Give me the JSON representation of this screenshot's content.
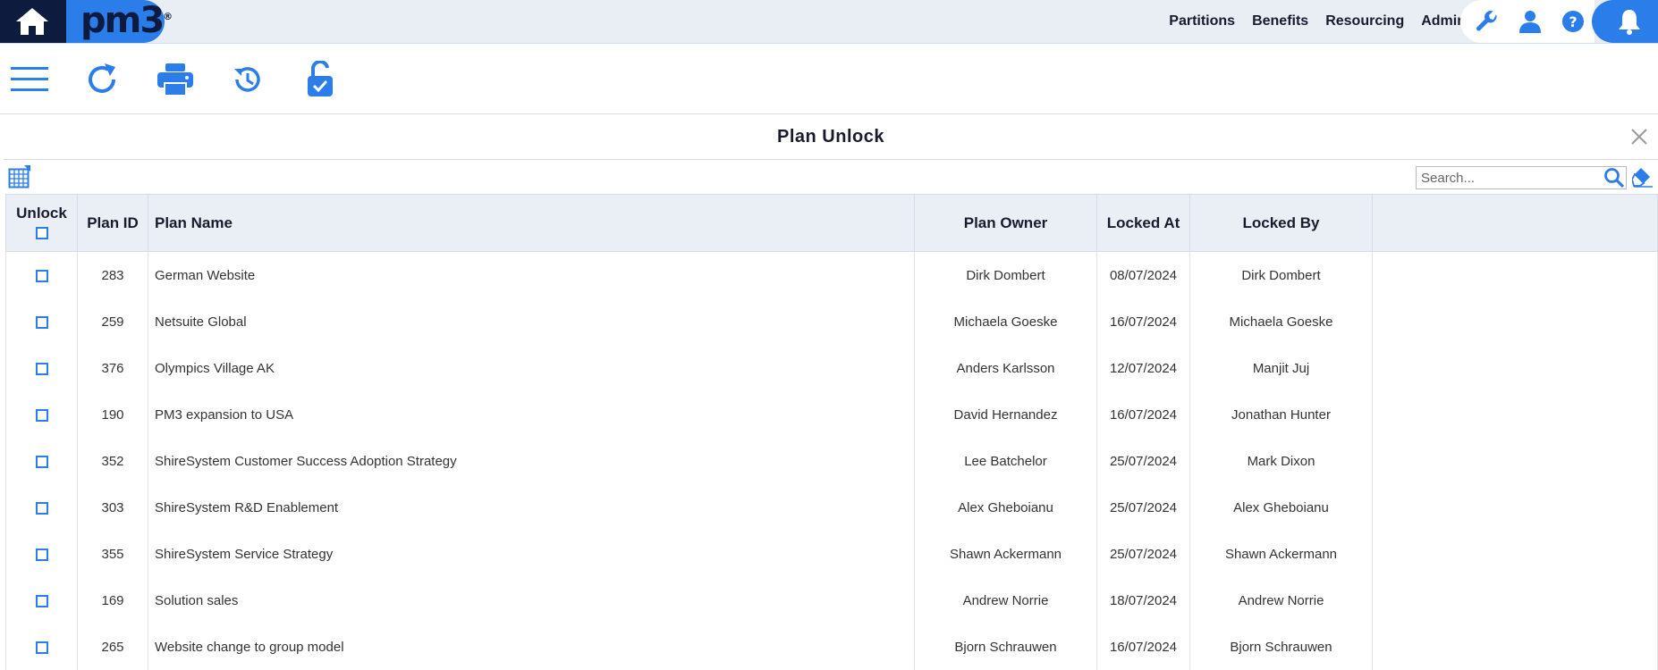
{
  "app": {
    "logo_text": "pm3",
    "logo_mark": "®",
    "brand_color": "#2b7de9",
    "dark_color": "#0d1b3e"
  },
  "nav": {
    "items": [
      "Partitions",
      "Benefits",
      "Resourcing",
      "Admin"
    ]
  },
  "header_icons": [
    "home-icon",
    "wrench-icon",
    "user-icon",
    "help-icon",
    "bell-icon"
  ],
  "toolbar": {
    "icons": [
      "menu-icon",
      "refresh-icon",
      "print-icon",
      "history-icon",
      "unlock-icon"
    ]
  },
  "dialog": {
    "title": "Plan Unlock",
    "search_placeholder": "Search...",
    "columns": {
      "unlock": "Unlock",
      "plan_id": "Plan ID",
      "plan_name": "Plan Name",
      "plan_owner": "Plan Owner",
      "locked_at": "Locked At",
      "locked_by": "Locked By"
    },
    "rows": [
      {
        "plan_id": "283",
        "plan_name": "German Website",
        "plan_owner": "Dirk Dombert",
        "locked_at": "08/07/2024",
        "locked_by": "Dirk Dombert"
      },
      {
        "plan_id": "259",
        "plan_name": "Netsuite Global",
        "plan_owner": "Michaela Goeske",
        "locked_at": "16/07/2024",
        "locked_by": "Michaela Goeske"
      },
      {
        "plan_id": "376",
        "plan_name": "Olympics Village AK",
        "plan_owner": "Anders Karlsson",
        "locked_at": "12/07/2024",
        "locked_by": "Manjit Juj"
      },
      {
        "plan_id": "190",
        "plan_name": "PM3 expansion to USA",
        "plan_owner": "David Hernandez",
        "locked_at": "16/07/2024",
        "locked_by": "Jonathan Hunter"
      },
      {
        "plan_id": "352",
        "plan_name": "ShireSystem Customer Success Adoption Strategy",
        "plan_owner": "Lee Batchelor",
        "locked_at": "25/07/2024",
        "locked_by": "Mark Dixon"
      },
      {
        "plan_id": "303",
        "plan_name": "ShireSystem R&D Enablement",
        "plan_owner": "Alex Gheboianu",
        "locked_at": "25/07/2024",
        "locked_by": "Alex Gheboianu"
      },
      {
        "plan_id": "355",
        "plan_name": "ShireSystem Service Strategy",
        "plan_owner": "Shawn Ackermann",
        "locked_at": "25/07/2024",
        "locked_by": "Shawn Ackermann"
      },
      {
        "plan_id": "169",
        "plan_name": "Solution sales",
        "plan_owner": "Andrew Norrie",
        "locked_at": "18/07/2024",
        "locked_by": "Andrew Norrie"
      },
      {
        "plan_id": "265",
        "plan_name": "Website change to group model",
        "plan_owner": "Bjorn Schrauwen",
        "locked_at": "16/07/2024",
        "locked_by": "Bjorn Schrauwen"
      }
    ]
  }
}
